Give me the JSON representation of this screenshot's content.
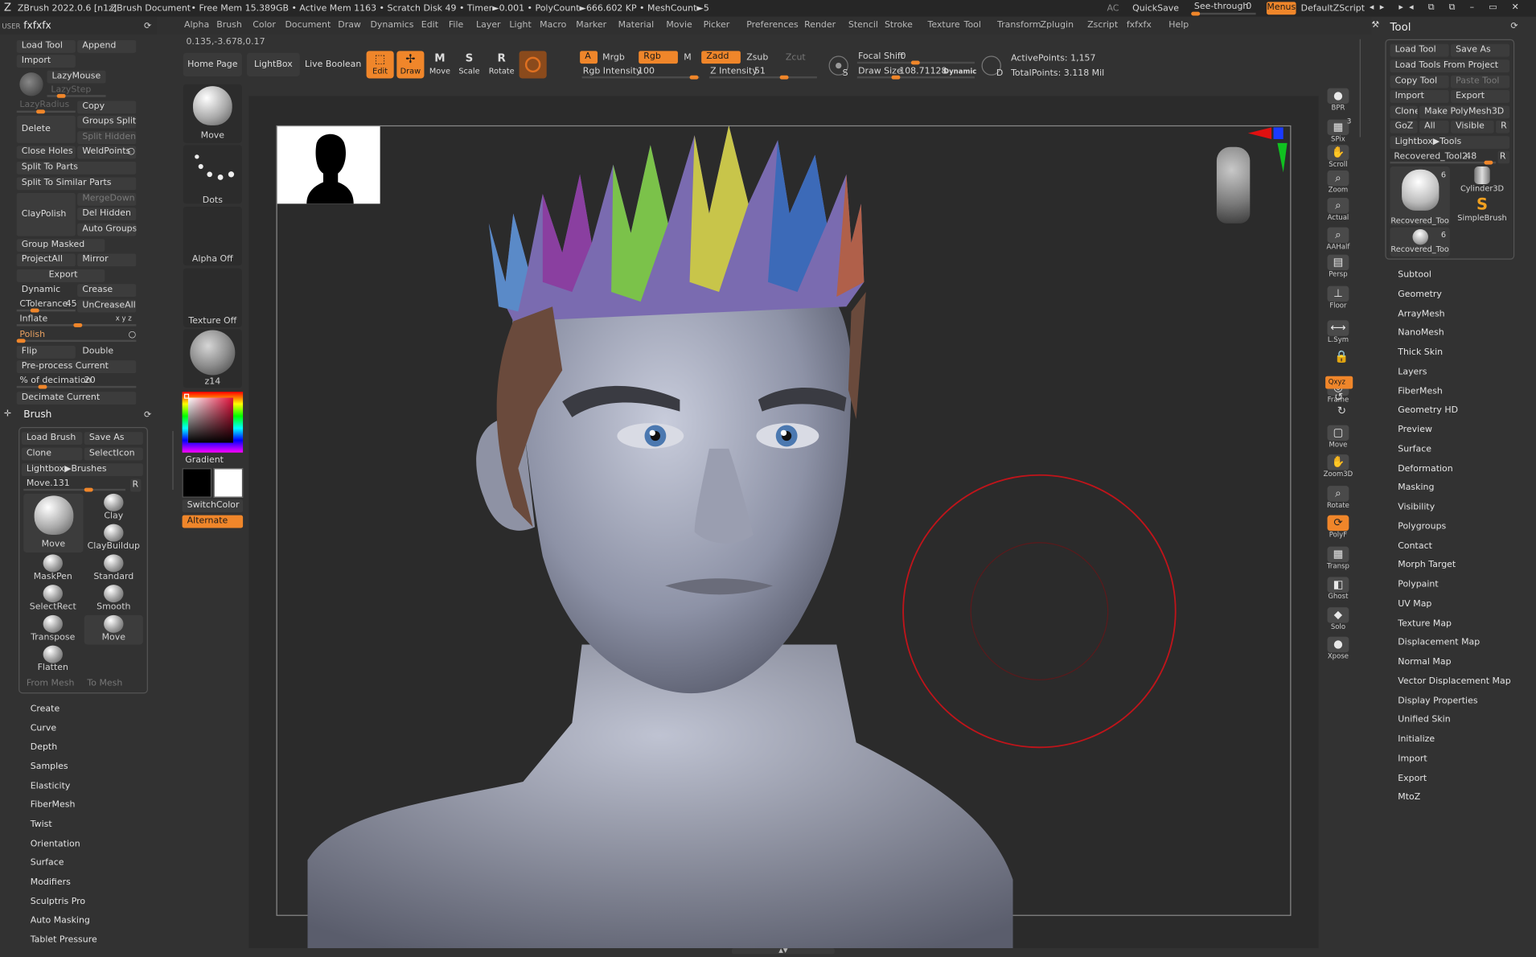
{
  "titlebar": {
    "app": "ZBrush 2022.0.6 [n1z]",
    "doc": "ZBrush Document",
    "stats": "• Free Mem 15.389GB • Active Mem 1163 • Scratch Disk 49 • Timer►0.001 • PolyCount►666.602 KP • MeshCount►5",
    "ac": "AC",
    "quicksave": "QuickSave",
    "seethrough": "See-through",
    "seethrough_val": "0",
    "menus": "Menus",
    "script": "DefaultZScript"
  },
  "menubar": [
    "Alpha",
    "Brush",
    "Color",
    "Document",
    "Draw",
    "Dynamics",
    "Edit",
    "File",
    "Layer",
    "Light",
    "Macro",
    "Marker",
    "Material",
    "Movie",
    "Picker",
    "Preferences",
    "Render",
    "Stencil",
    "Stroke",
    "Texture",
    "Tool",
    "Transform",
    "Zplugin",
    "Zscript",
    "fxfxfx",
    "Help"
  ],
  "coords": "0.135,-3.678,0.17",
  "toolbar": {
    "home": "Home Page",
    "lightbox": "LightBox",
    "liveboolean": "Live Boolean",
    "edit": "Edit",
    "draw": "Draw",
    "move": "Move",
    "scale": "Scale",
    "rotate": "Rotate",
    "a": "A",
    "mrgb": "Mrgb",
    "rgb": "Rgb",
    "m": "M",
    "zadd": "Zadd",
    "zsub": "Zsub",
    "zcut": "Zcut",
    "rgb_intensity": "Rgb Intensity",
    "rgb_intensity_val": "100",
    "z_intensity": "Z Intensity",
    "z_intensity_val": "51",
    "focal_shift": "Focal Shift",
    "focal_shift_val": "0",
    "draw_size": "Draw Size",
    "draw_size_val": "108.71128",
    "dynamic": "Dynamic",
    "s": "S",
    "d": "D",
    "active_points": "ActivePoints: 1,157",
    "total_points": "TotalPoints: 3.118 Mil"
  },
  "left": {
    "user": "USER",
    "name": "fxfxfx",
    "load_tool": "Load Tool",
    "append": "Append",
    "import": "Import",
    "lazymouse": "LazyMouse",
    "lazystep": "LazyStep",
    "lazyradius": "LazyRadius",
    "copy": "Copy",
    "delete": "Delete",
    "groups_split": "Groups Split",
    "split_hidden": "Split Hidden",
    "close_holes": "Close Holes",
    "weldpoints": "WeldPoints",
    "split_to_parts": "Split To Parts",
    "split_similar": "Split To Similar Parts",
    "claypolish": "ClayPolish",
    "mergedown": "MergeDown",
    "del_hidden": "Del Hidden",
    "auto_groups": "Auto Groups",
    "group_masked": "Group Masked",
    "projectall": "ProjectAll",
    "mirror": "Mirror",
    "export": "Export",
    "dynamic": "Dynamic",
    "crease": "Crease",
    "ctolerance": "CTolerance",
    "ctolerance_val": "45",
    "uncreaseall": "UnCreaseAll",
    "inflate": "Inflate",
    "xyz": "x y z",
    "polish": "Polish",
    "flip": "Flip",
    "double": "Double",
    "preprocess": "Pre-process Current",
    "decimation": "% of decimation",
    "decimation_val": "20",
    "decimate": "Decimate Current"
  },
  "brush": {
    "title": "Brush",
    "load": "Load Brush",
    "saveas": "Save As",
    "clone": "Clone",
    "selecticon": "SelectIcon",
    "lightbox": "Lightbox▶Brushes",
    "move": "Move.",
    "move_val": "131",
    "r": "R",
    "items": [
      "Clay",
      "ClayBuildup",
      "Standard",
      "Smooth",
      "Move"
    ],
    "left_items": [
      "MaskPen",
      "SelectRect",
      "Transpose",
      "Flatten"
    ],
    "main": "Move",
    "frommesh": "From Mesh",
    "tomesh": "To Mesh"
  },
  "leftlist": [
    "Create",
    "Curve",
    "Depth",
    "Samples",
    "Elasticity",
    "FiberMesh",
    "Twist",
    "Orientation",
    "Surface",
    "Modifiers",
    "Sculptris Pro",
    "Auto Masking",
    "Tablet Pressure"
  ],
  "shelf": {
    "move": "Move",
    "dots": "Dots",
    "alpha": "Alpha Off",
    "texture": "Texture Off",
    "material": "z14",
    "gradient": "Gradient",
    "switchcolor": "SwitchColor",
    "alternate": "Alternate"
  },
  "nav": [
    "BPR",
    "SPix",
    "Scroll",
    "Zoom",
    "Actual",
    "AAHalf",
    "Persp",
    "Floor",
    "L.Sym",
    "",
    "Frame",
    "Move",
    "Zoom3D",
    "Rotate",
    "PolyF",
    "Transp",
    "Ghost",
    "Solo",
    "Xpose"
  ],
  "spix_val": "3",
  "xyz_label": "Qxyz",
  "tool": {
    "title": "Tool",
    "load": "Load Tool",
    "saveas": "Save As",
    "load_proj": "Load Tools From Project",
    "copy": "Copy Tool",
    "paste": "Paste Tool",
    "import": "Import",
    "export": "Export",
    "clone": "Clone",
    "make": "Make PolyMesh3D",
    "goz": "GoZ",
    "all": "All",
    "visible": "Visible",
    "r": "R",
    "lightbox": "Lightbox▶Tools",
    "recovered": "Recovered_Tool2.",
    "recovered_val": "48",
    "thumbs": [
      "Recovered_Too",
      "Cylinder3D",
      "SimpleBrush",
      "Recovered_Too"
    ],
    "thumb_counts": [
      "6",
      "6"
    ]
  },
  "toollist": [
    "Subtool",
    "Geometry",
    "ArrayMesh",
    "NanoMesh",
    "Thick Skin",
    "Layers",
    "FiberMesh",
    "Geometry HD",
    "Preview",
    "Surface",
    "Deformation",
    "Masking",
    "Visibility",
    "Polygroups",
    "Contact",
    "Morph Target",
    "Polypaint",
    "UV Map",
    "Texture Map",
    "Displacement Map",
    "Normal Map",
    "Vector Displacement Map",
    "Display Properties",
    "Unified Skin",
    "Initialize",
    "Import",
    "Export",
    "MtoZ"
  ],
  "colors": {
    "accent": "#f0862a",
    "bg": "#323232",
    "canvas": "#2b2b2b",
    "brush_ring": "#c0141a"
  }
}
